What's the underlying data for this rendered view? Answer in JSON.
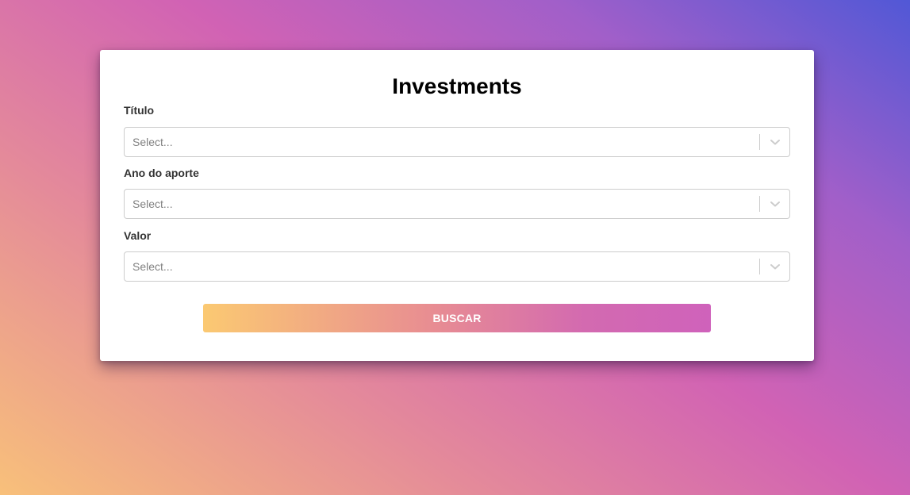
{
  "page": {
    "title": "Investments"
  },
  "form": {
    "fields": [
      {
        "label": "Título",
        "placeholder": "Select..."
      },
      {
        "label": "Ano do aporte",
        "placeholder": "Select..."
      },
      {
        "label": "Valor",
        "placeholder": "Select..."
      }
    ],
    "submit_label": "BUSCAR"
  },
  "icons": {
    "dropdown": "chevron-down-icon"
  },
  "colors": {
    "background_gradient": [
      "#f8c07a",
      "#e48a9a",
      "#d162b4",
      "#a15fc9",
      "#5158d6"
    ],
    "button_gradient": [
      "#fbc972",
      "#e88d92",
      "#d36ab0",
      "#cf62bb"
    ],
    "card": "#ffffff",
    "placeholder_text": "#808080",
    "select_border": "#cccccc"
  }
}
